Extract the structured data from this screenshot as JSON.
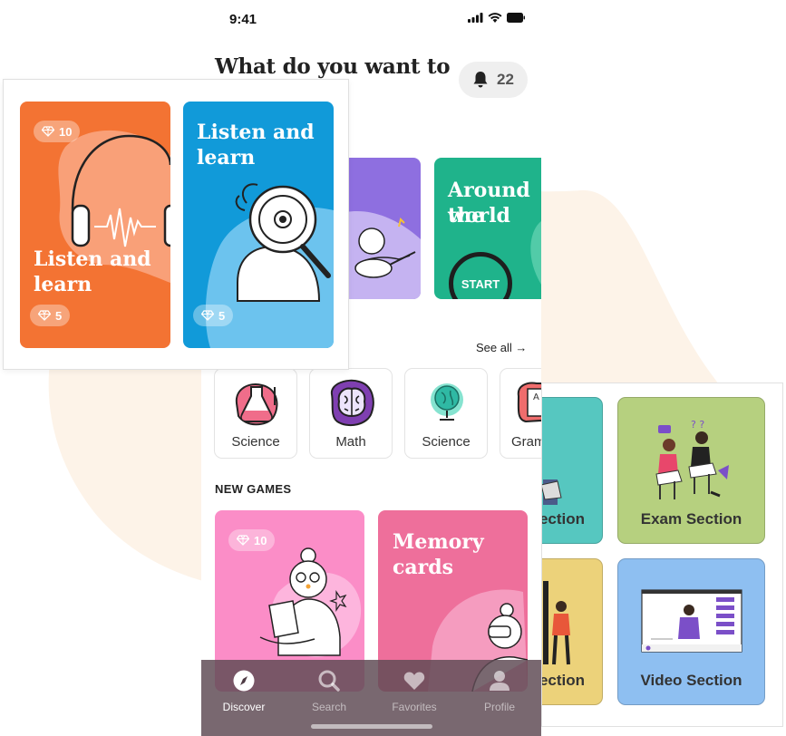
{
  "status_bar": {
    "time": "9:41"
  },
  "header": {
    "title": "What do you want to",
    "notification_count": "22"
  },
  "featured": {
    "cards": [
      {
        "title_line1": "Listen and",
        "title_line2": "learn",
        "top_gems": "10",
        "bottom_gems": "5",
        "color": "#f37333"
      },
      {
        "title_line1": "Listen and",
        "title_line2": "learn",
        "bottom_gems": "5",
        "color": "#119ad9"
      },
      {
        "title_line1": "Around the",
        "title_line2": "world",
        "start_label": "START",
        "color": "#1fb38b"
      }
    ]
  },
  "categories": {
    "see_all_label": "See all →",
    "items": [
      {
        "label": "Science"
      },
      {
        "label": "Math"
      },
      {
        "label": "Science"
      },
      {
        "label": "Gram"
      }
    ]
  },
  "new_games": {
    "heading": "NEW GAMES",
    "cards": [
      {
        "gems": "10",
        "color": "#fb8dc7"
      },
      {
        "title_line1": "Memory",
        "title_line2": "cards",
        "color": "#ee6f9b"
      }
    ]
  },
  "tabbar": {
    "tabs": [
      {
        "label": "Discover",
        "icon": "compass-icon",
        "active": true
      },
      {
        "label": "Search",
        "icon": "search-icon"
      },
      {
        "label": "Favorites",
        "icon": "heart-icon"
      },
      {
        "label": "Profile",
        "icon": "user-icon"
      }
    ]
  },
  "sections": {
    "items": [
      {
        "label": "ection",
        "color": "#56c7c0"
      },
      {
        "label": "Exam Section",
        "color": "#b6d07f"
      },
      {
        "label": "ection",
        "color": "#ecd27a"
      },
      {
        "label": "Video Section",
        "color": "#8ebff1"
      }
    ]
  },
  "colors": {
    "accent_orange": "#f37333",
    "accent_blue": "#119ad9",
    "accent_green": "#1fb38b",
    "accent_purple": "#8e6fe0",
    "blob": "#fdf3e8"
  }
}
